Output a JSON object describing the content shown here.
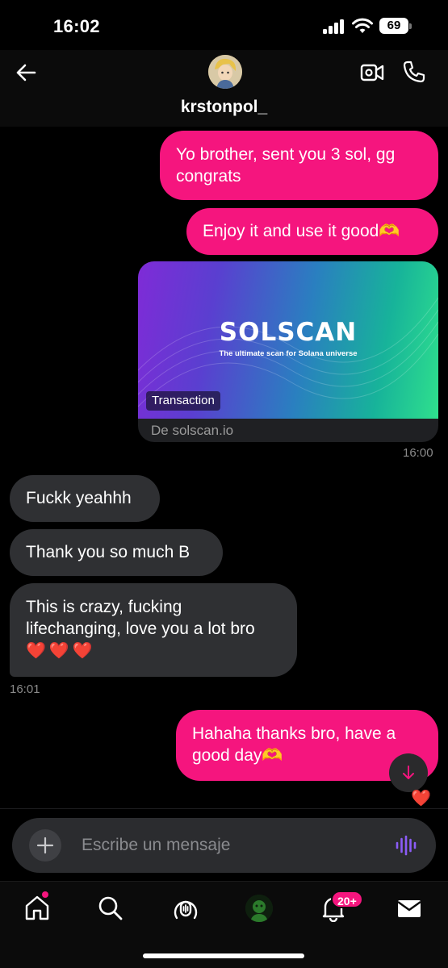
{
  "status_bar": {
    "time": "16:02",
    "battery": "69"
  },
  "header": {
    "contact_name": "krstonpol_"
  },
  "messages": [
    {
      "direction": "out",
      "text": "Yo brother, sent you 3 sol, gg congrats"
    },
    {
      "direction": "out",
      "text": "Enjoy it and use it good🫶"
    },
    {
      "direction": "out",
      "type": "link",
      "logo": "SOLSCAN",
      "tagline": "The ultimate scan for Solana universe",
      "chip": "Transaction",
      "domain": "De solscan.io"
    },
    {
      "direction": "in",
      "text": "Fuckk yeahhh"
    },
    {
      "direction": "in",
      "text": "Thank you so much B"
    },
    {
      "direction": "in",
      "text": "This is crazy, fucking lifechanging, love you a lot bro",
      "hearts": "❤️❤️❤️"
    },
    {
      "direction": "out",
      "text": "Hahaha thanks bro, have a good day🫶",
      "reaction": "❤️"
    }
  ],
  "timestamps": {
    "after_link": "16:00",
    "after_incoming": "16:01"
  },
  "composer": {
    "placeholder": "Escribe un mensaje"
  },
  "nav": {
    "notifications_badge": "20+"
  },
  "colors": {
    "accent": "#f5157e",
    "incoming_bubble": "#2f3033",
    "background": "#000000",
    "voice_icon": "#8b5cf6"
  },
  "icons": [
    "back-arrow-icon",
    "video-call-icon",
    "phone-icon",
    "plus-icon",
    "voice-waveform-icon",
    "home-icon",
    "search-icon",
    "spaces-icon",
    "grok-icon",
    "bell-icon",
    "mail-icon",
    "arrow-down-icon"
  ]
}
